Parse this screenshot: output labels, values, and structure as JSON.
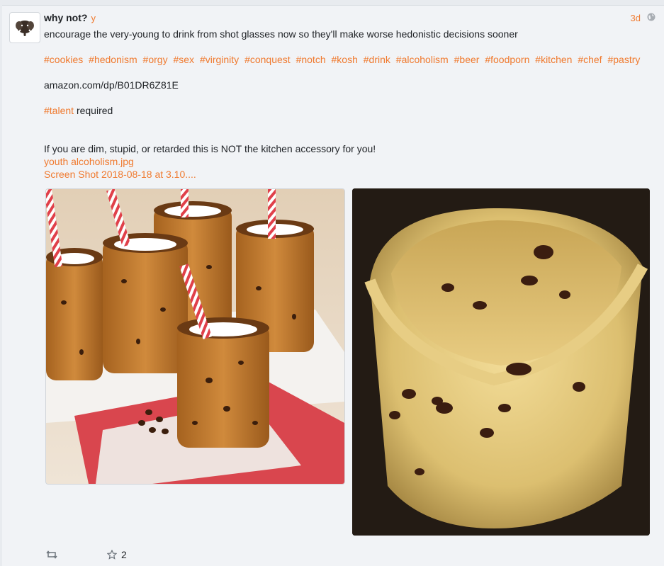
{
  "post": {
    "display_name": "why not?",
    "username": "y",
    "time": "3d",
    "text": "encourage the very-young to drink from shot glasses now so they'll make worse hedonistic decisions sooner",
    "hashtags": [
      "#cookies",
      "#hedonism",
      "#orgy",
      "#sex",
      "#virginity",
      "#conquest",
      "#notch",
      "#kosh",
      "#drink",
      "#alcoholism",
      "#beer",
      "#foodporn",
      "#kitchen",
      "#chef",
      "#pastry"
    ],
    "amazon": "amazon.com/dp/B01DR6Z81E",
    "talent_tag": "#talent",
    "talent_rest": "required",
    "warning": "If you are dim, stupid, or retarded this is NOT the kitchen accessory for you!",
    "attachments": [
      "youth alcoholism.jpg",
      "Screen Shot 2018-08-18 at 3.10...."
    ],
    "star_count": "2"
  },
  "icons": {
    "avatar": "mammoth-avatar-icon",
    "privacy": "globe-icon",
    "repost": "repost-icon",
    "star": "star-icon"
  },
  "colors": {
    "accent": "#f07a2f",
    "background": "#f1f3f6",
    "text": "#1f2226"
  }
}
